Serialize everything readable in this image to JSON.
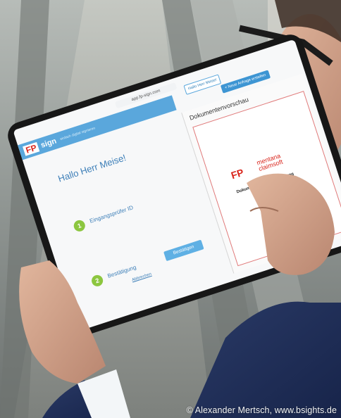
{
  "browser": {
    "url": "app.fp-sign.com"
  },
  "app": {
    "logo": "FP",
    "name": "sign",
    "tagline": "einfach digital signieren",
    "user_menu": "Hallo Herr Meise!",
    "new_request_button": "+ Neue Anfrage erstellen"
  },
  "main": {
    "greeting": "Hallo Herr Meise!",
    "steps": [
      {
        "number": "1",
        "title": "Eingangsprüfer ID"
      },
      {
        "number": "2",
        "title": "Bestätigung"
      }
    ],
    "confirm_button": "Bestätigen",
    "back_link": "Abbrechen"
  },
  "preview": {
    "title": "Dokumentenvorschau",
    "doc_logo": "FP",
    "doc_brand_line1": "mentana",
    "doc_brand_line2": "claimsoft",
    "doc_heading": "Dokumentationsvereinbarung"
  },
  "credit": "© Alexander Mertsch, www.bsights.de",
  "colors": {
    "accent": "#5aa7dc",
    "brand_red": "#d9251c",
    "step_green": "#8cc63f"
  }
}
